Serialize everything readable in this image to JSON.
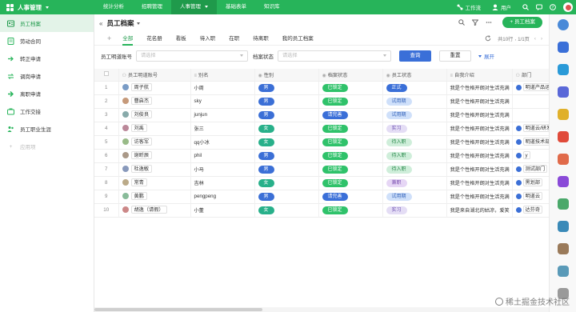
{
  "app": {
    "name": "人事管理"
  },
  "topnav": [
    "统计分析",
    "招聘管理",
    "人事管理",
    "基础表单",
    "知识库"
  ],
  "topnav_active": 2,
  "topbar_right": {
    "workflow": "工作流",
    "users": "用户"
  },
  "sidebar": {
    "items": [
      {
        "label": "员工档案",
        "icon": "profile-icon"
      },
      {
        "label": "劳动合同",
        "icon": "contract-icon"
      },
      {
        "label": "转正申请",
        "icon": "regularize-icon"
      },
      {
        "label": "调岗申请",
        "icon": "transfer-icon"
      },
      {
        "label": "离职申请",
        "icon": "resign-icon"
      },
      {
        "label": "工作交接",
        "icon": "handover-icon"
      },
      {
        "label": "员工职业生涯",
        "icon": "career-icon"
      }
    ],
    "add_label": "应用项"
  },
  "page": {
    "title": "员工档案",
    "add_button": "+ 员工档案"
  },
  "tabs": [
    "全部",
    "花名册",
    "看板",
    "待入职",
    "在职",
    "待离职",
    "我的员工档案"
  ],
  "pagination": {
    "total": "共10行",
    "page": "1/1页"
  },
  "filter": {
    "label1": "员工明道账号",
    "placeholder1": "请选择",
    "label2": "档案状态",
    "placeholder2": "请选择",
    "query": "查询",
    "reset": "重置",
    "expand": "展开"
  },
  "table": {
    "headers": [
      "员工明道账号",
      "别名",
      "性别",
      "档案状态",
      "员工状态",
      "自我介绍",
      "部门"
    ],
    "rows": [
      {
        "no": "1",
        "account": "周子航",
        "alias": "小周",
        "gender": "男",
        "archive": "已锁定",
        "status": "正式",
        "intro": "我是个性格开朗对生活充满",
        "dept": "明道产品运"
      },
      {
        "no": "2",
        "account": "曹启杰",
        "alias": "sky",
        "gender": "男",
        "archive": "已锁定",
        "status": "试用期",
        "intro": "我是个性格开朗对生活充满",
        "dept": ""
      },
      {
        "no": "3",
        "account": "刘俊良",
        "alias": "junjun",
        "gender": "男",
        "archive": "请完善",
        "status": "试用期",
        "intro": "我是个性格开朗对生活充满",
        "dept": ""
      },
      {
        "no": "4",
        "account": "刘禹",
        "alias": "张三",
        "gender": "女",
        "archive": "已锁定",
        "status": "实习",
        "intro": "我是个性格开朗对生活充满",
        "dept": "明道云/研发"
      },
      {
        "no": "5",
        "account": "访客军",
        "alias": "qq小冰",
        "gender": "女",
        "archive": "已锁定",
        "status": "待入职",
        "intro": "我是个性格开朗对生活充满",
        "dept": "明道技术部"
      },
      {
        "no": "6",
        "account": "谢昕辰",
        "alias": "phil",
        "gender": "男",
        "archive": "已锁定",
        "status": "待入职",
        "intro": "我是个性格开朗对生活充满",
        "dept": "y"
      },
      {
        "no": "7",
        "account": "杜逸敏",
        "alias": "小马",
        "gender": "男",
        "archive": "已锁定",
        "status": "待入职",
        "intro": "我是个性格开朗对生活充满",
        "dept": "测试部门"
      },
      {
        "no": "8",
        "account": "常青",
        "alias": "吉林",
        "gender": "女",
        "archive": "已锁定",
        "status": "兼职",
        "intro": "我是个性格开朗对生活充满",
        "dept": "黑划部"
      },
      {
        "no": "9",
        "account": "黄鹏",
        "alias": "pengpeng",
        "gender": "男",
        "archive": "请完善",
        "status": "试用期",
        "intro": "我是个性格开朗对生活充满",
        "dept": "明道云"
      },
      {
        "no": "10",
        "account": "胡逸（请假）",
        "alias": "小董",
        "gender": "女",
        "archive": "已锁定",
        "status": "实习",
        "intro": "我是来自湖北的姑凉，爱笑",
        "dept": "达芬奇"
      }
    ]
  },
  "watermark": "稀土掘金技术社区",
  "colors": {
    "brand": "#27b45a",
    "male": "#3b6fd6",
    "female": "#28b08a",
    "archive_locked": "#2fc26a",
    "archive_complete": "#3a6fd8"
  }
}
